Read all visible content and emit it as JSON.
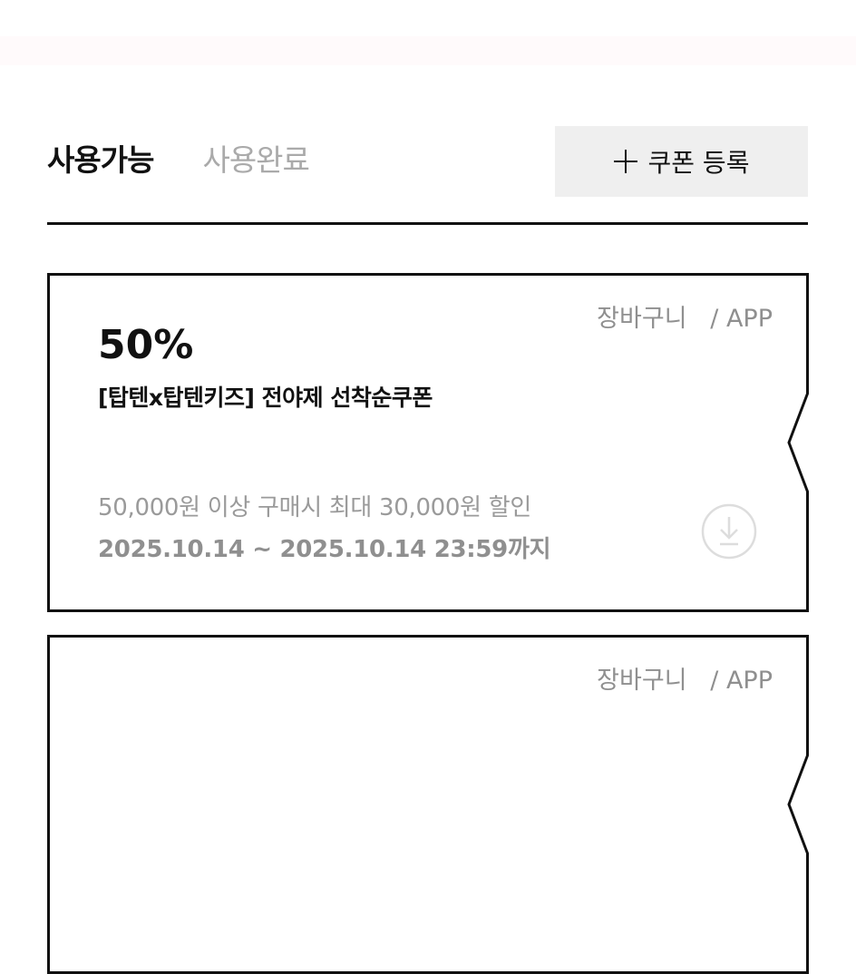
{
  "tabs": {
    "available": "사용가능",
    "used": "사용완료"
  },
  "register_button": {
    "label": "쿠폰 등록",
    "icon": "plus-icon"
  },
  "coupons": [
    {
      "channel": "장바구니   / APP",
      "rate": "50%",
      "title": "[탑텐x탑텐키즈] 전야제 선착순쿠폰",
      "condition": "50,000원 이상 구매시 최대 30,000원 할인",
      "period": "2025.10.14 ~ 2025.10.14 23:59까지",
      "action_icon": "download-icon"
    },
    {
      "channel": "장바구니   / APP"
    }
  ],
  "colors": {
    "text": "#111111",
    "muted": "#aaaaaa",
    "button_bg": "#efefef",
    "icon": "#dddddd"
  }
}
